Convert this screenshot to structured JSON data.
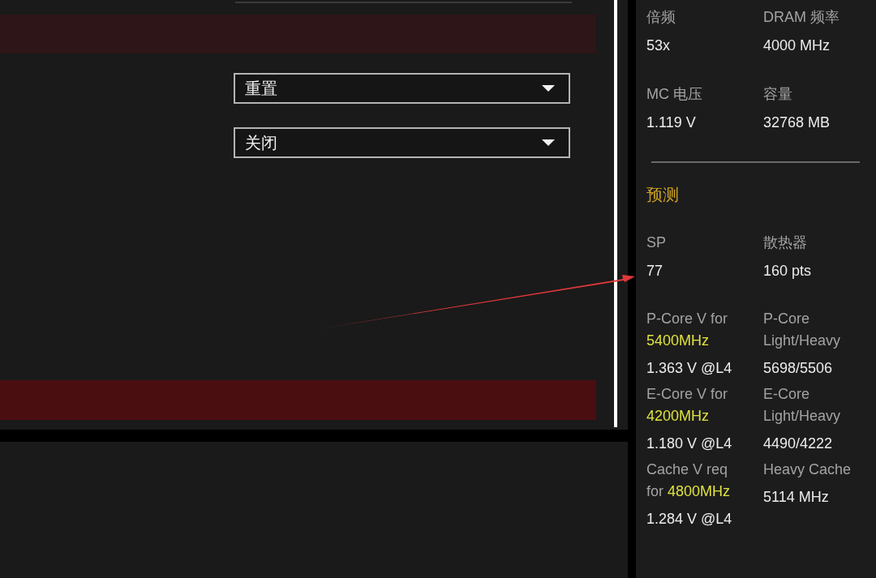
{
  "settings": {
    "dropdowns": [
      {
        "value": "重置"
      },
      {
        "value": "关闭"
      }
    ]
  },
  "info_panel": {
    "stats": [
      {
        "label": "倍频",
        "value": "53x"
      },
      {
        "label": "DRAM 频率",
        "value": "4000 MHz"
      },
      {
        "label": "MC 电压",
        "value": "1.119 V"
      },
      {
        "label": "容量",
        "value": "32768 MB"
      }
    ],
    "prediction": {
      "title": "预测",
      "rows": [
        [
          {
            "label": "SP",
            "value": "77"
          },
          {
            "label": "散热器",
            "value": "160 pts"
          }
        ],
        [
          {
            "label": "P-Core V for",
            "highlight": "5400MHz",
            "value": "1.363 V @L4"
          },
          {
            "label": "P-Core Light/Heavy",
            "value": "5698/5506"
          }
        ],
        [
          {
            "label": "E-Core V for",
            "highlight": "4200MHz",
            "value": "1.180 V @L4"
          },
          {
            "label": "E-Core Light/Heavy",
            "value": "4490/4222"
          }
        ],
        [
          {
            "label": "Cache V req for",
            "highlight": "4800MHz",
            "value": "1.284 V @L4"
          },
          {
            "label": "Heavy Cache",
            "value": "5114 MHz"
          }
        ]
      ]
    }
  }
}
